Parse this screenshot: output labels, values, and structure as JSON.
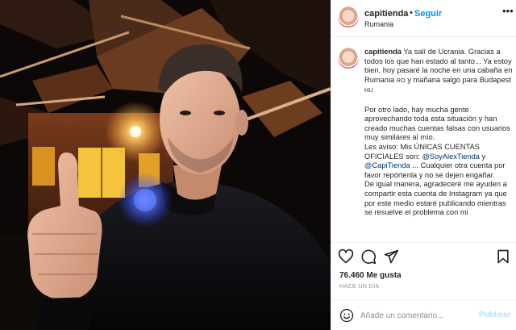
{
  "post": {
    "username": "capitienda",
    "follow_label": "Seguir",
    "location": "Rumania",
    "more_icon": "more-options-icon",
    "avatar_icon": "profile-avatar"
  },
  "caption": {
    "username": "capitienda",
    "p1a": "Ya salí de Ucrania. Gracias a todos los que han estado al tanto... Ya estoy bien, hoy pasaré la noche en una cabaña en Rumania",
    "p1_flag1": "RO",
    "p1b": "y mañana salgo para Budapest",
    "p1_flag2": "HU",
    "p2": "Por otro lado, hay mucha gente aprovechando toda esta situación y han creado muchas cuentas falsas con usuarios muy similares al mío.",
    "p3": "Les aviso: Mis ÚNICAS CUENTAS OFICIALES son:",
    "mention1": "@SoyAlexTienda",
    "p3_and": "y",
    "mention2": "@CapiTienda",
    "p3b": "... Cualquier otra cuenta por favor repórtenla y no se dejen engañar.",
    "p4": "De igual manera, agradeceré me ayuden a compartir esta cuenta de Instagram ya que por este medio estaré publicando mientras se resuelve el problema con mi"
  },
  "actions": {
    "like_icon": "heart-icon",
    "comment_icon": "comment-icon",
    "share_icon": "share-icon",
    "save_icon": "bookmark-icon"
  },
  "likes_label": "76.460 Me gusta",
  "time_label": "HACE UN DÍA",
  "comment_box": {
    "emoji_icon": "emoji-icon",
    "placeholder": "Añade un comentario...",
    "post_label": "Publicar"
  },
  "colors": {
    "link_blue": "#0095f6",
    "mention_blue": "#00376b",
    "publish_disabled": "#b2dffc",
    "text": "#262626",
    "muted": "#8e8e8e"
  }
}
